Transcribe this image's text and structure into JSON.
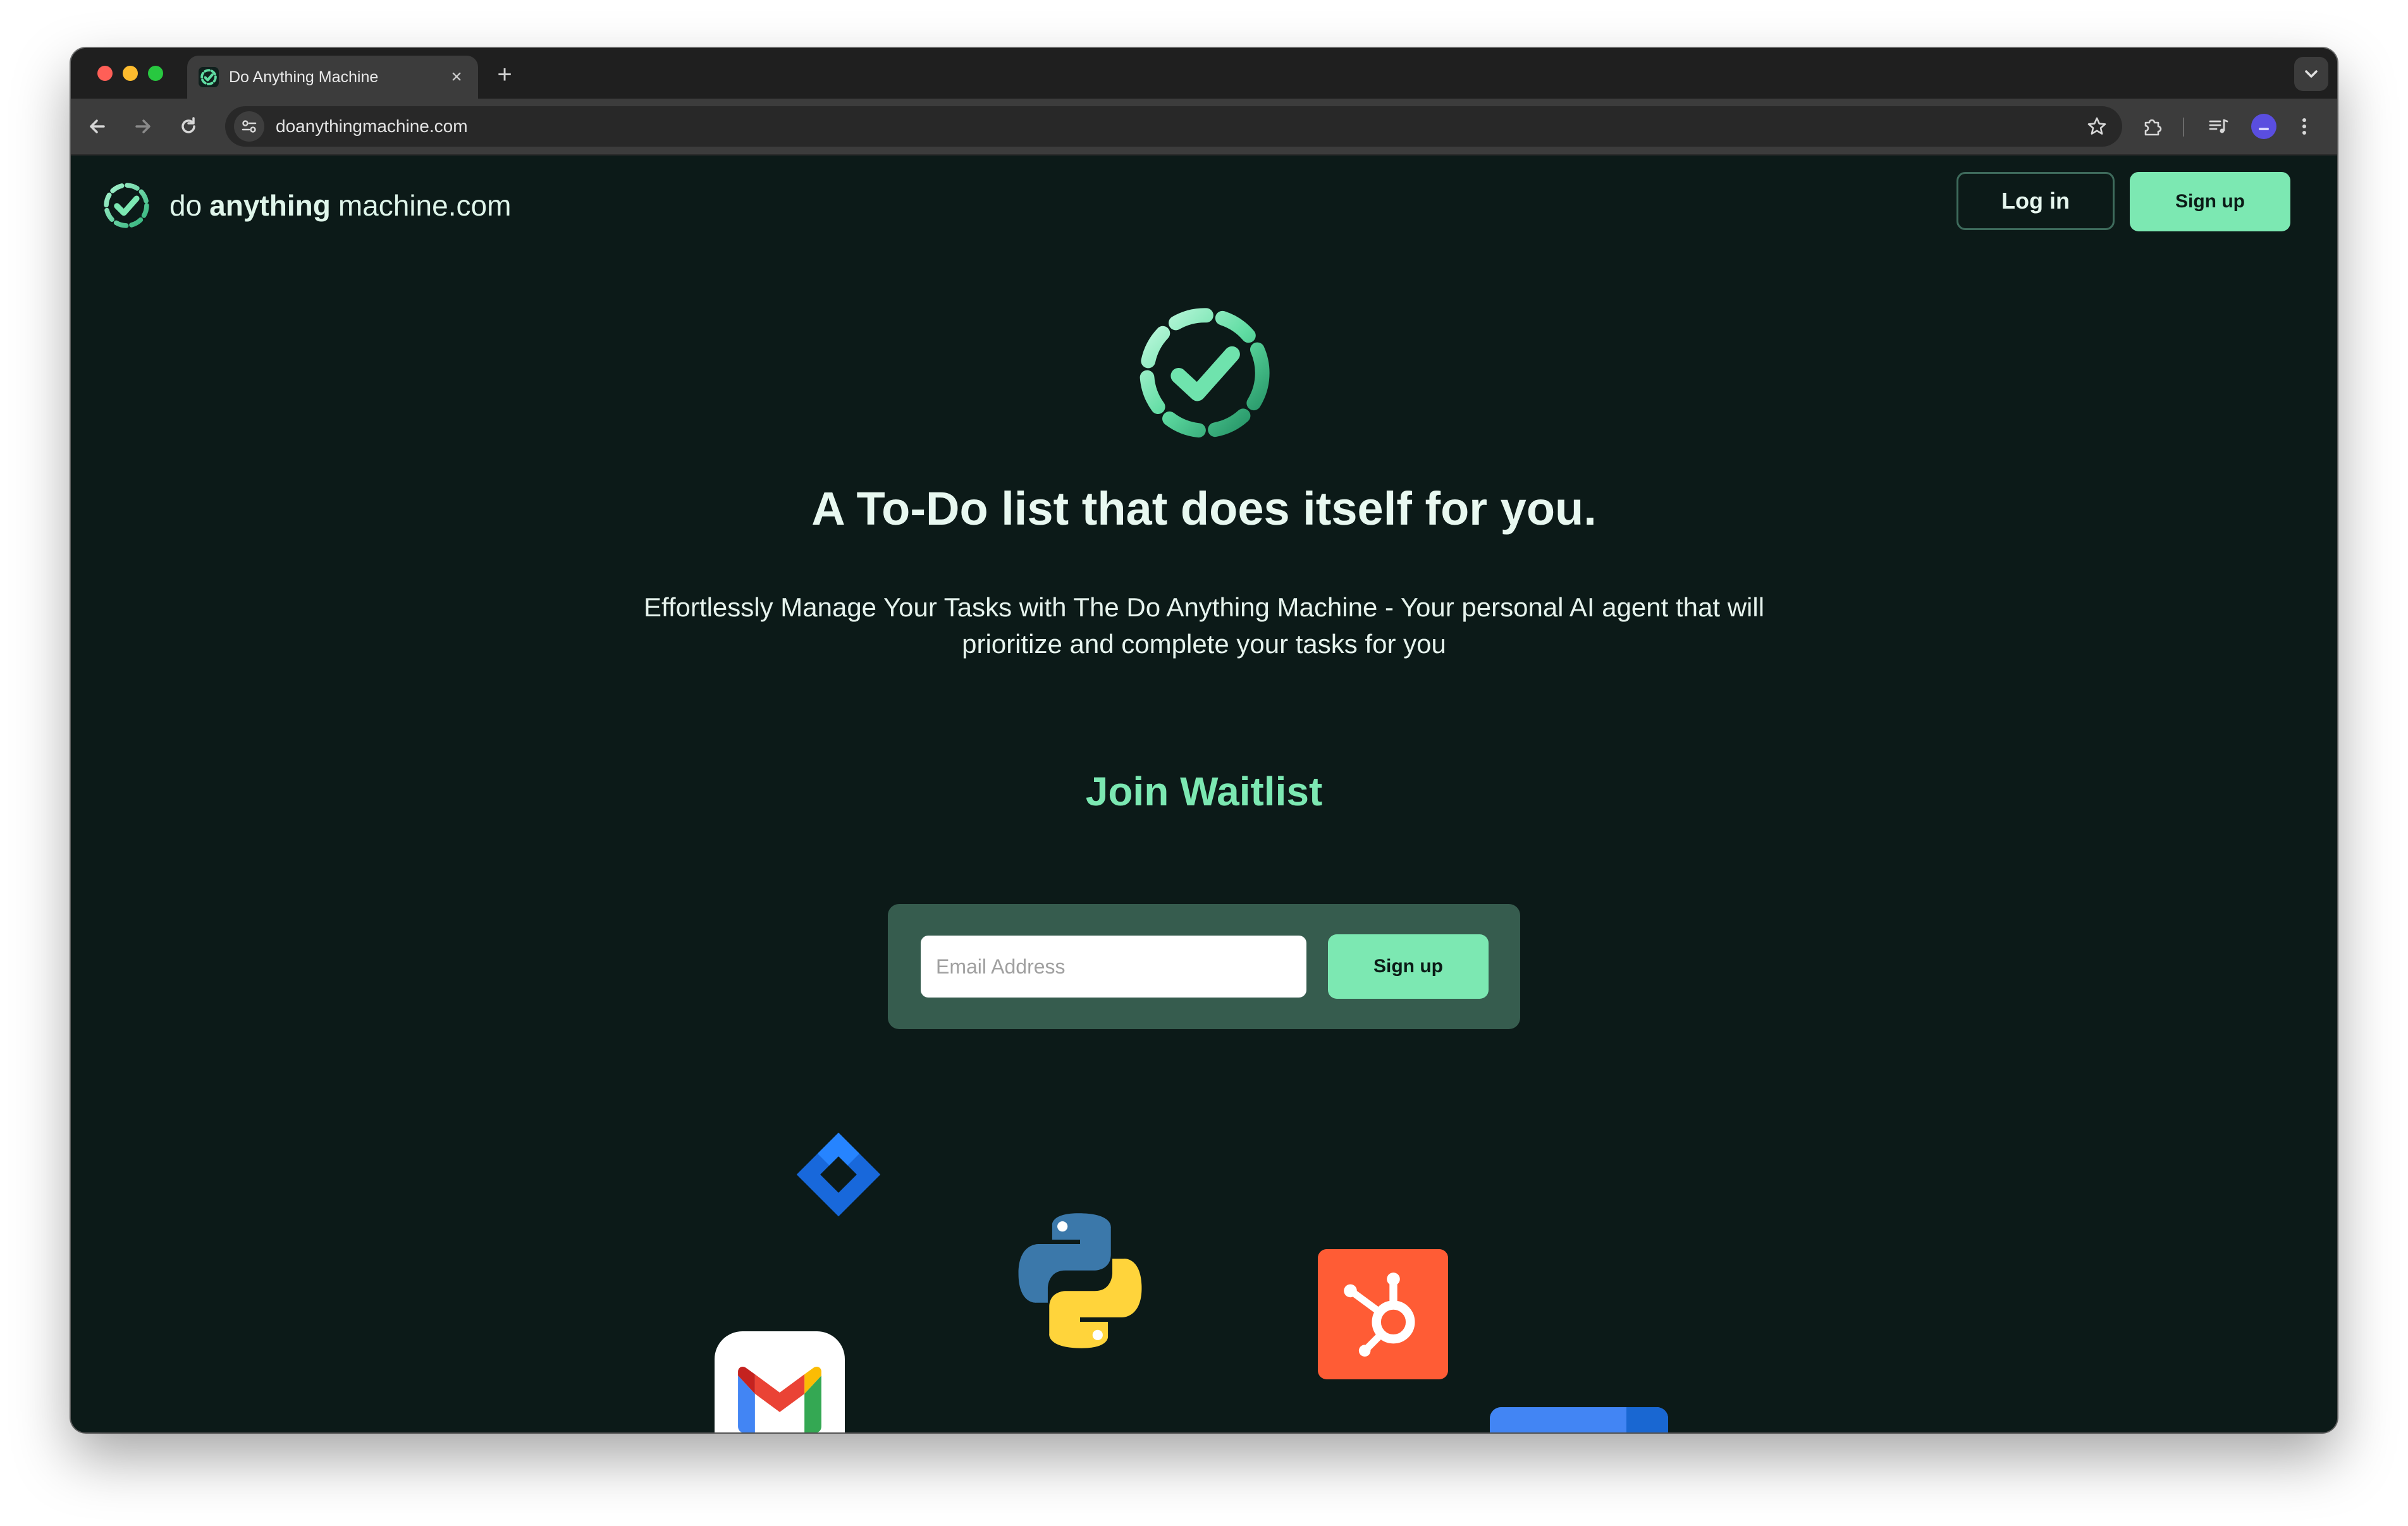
{
  "browser": {
    "tab": {
      "title": "Do Anything Machine",
      "close_glyph": "×"
    },
    "new_tab_glyph": "+",
    "url": "doanythingmachine.com",
    "icons": {
      "back": "arrow-left-icon",
      "forward": "arrow-right-icon",
      "reload": "reload-icon",
      "site_info": "tune-icon",
      "bookmark": "star-icon",
      "extensions": "puzzle-icon",
      "media": "media-queue-icon",
      "profile": "profile-avatar",
      "menu": "kebab-menu-icon",
      "tab_search": "chevron-down-icon"
    }
  },
  "site": {
    "brand": {
      "do": "do",
      "anything": "anything",
      "machine": "machine.com"
    },
    "nav": {
      "login_label": "Log in",
      "signup_label": "Sign up"
    },
    "hero": {
      "headline": "A To-Do list that does itself for you.",
      "subtitle": "Effortlessly Manage Your Tasks with The Do Anything Machine  - Your personal AI agent that will prioritize and complete your tasks for you"
    },
    "waitlist": {
      "title": "Join Waitlist",
      "email_placeholder": "Email Address",
      "email_value": "",
      "signup_label": "Sign up"
    },
    "integrations": [
      "jira-icon",
      "python-icon",
      "hubspot-icon",
      "gmail-icon",
      "google-calendar-icon"
    ]
  },
  "colors": {
    "page_bg": "#0c1a18",
    "accent": "#7ce8b2",
    "waitlist_box": "#365c4e",
    "text": "#e8f8f0"
  }
}
